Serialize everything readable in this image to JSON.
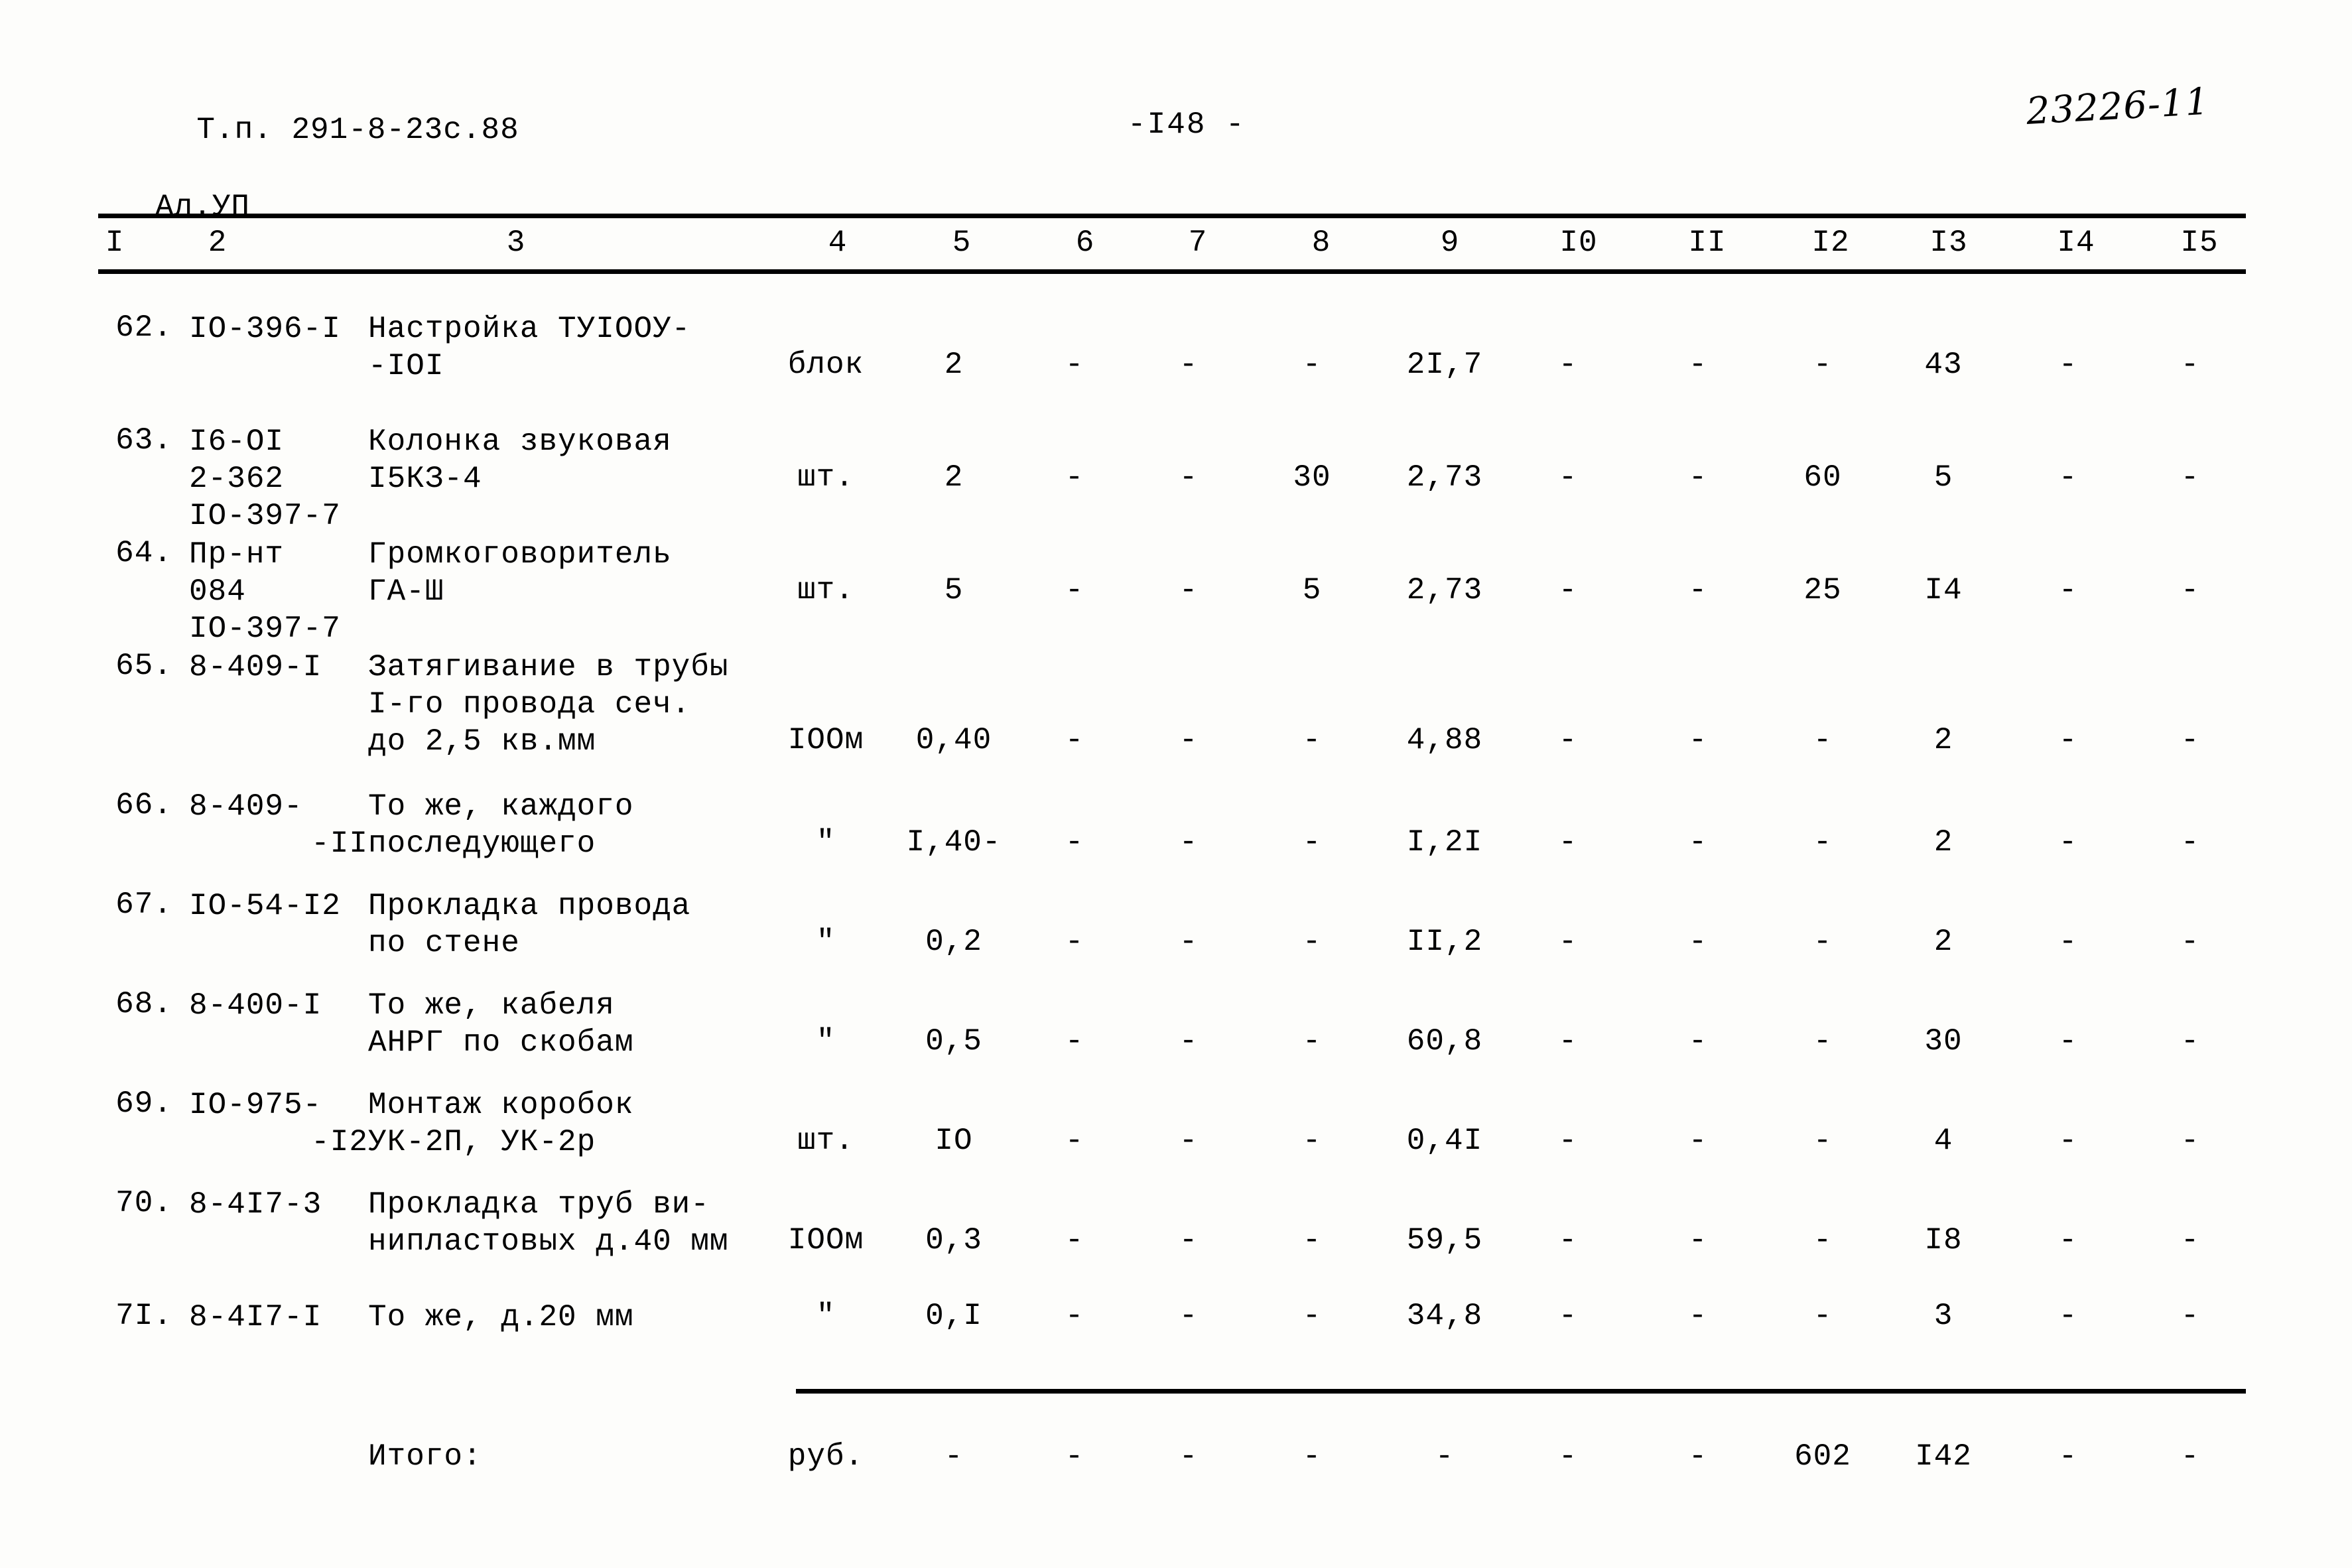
{
  "header": {
    "doc_code_line1": "Т.п. 291-8-23с.88",
    "doc_code_line2": "Ал.УП",
    "page_number": "-I48 -",
    "handwritten_note": "23226-11"
  },
  "table": {
    "column_headers": [
      "I",
      "2",
      "3",
      "4",
      "5",
      "6",
      "7",
      "8",
      "9",
      "I0",
      "II",
      "I2",
      "I3",
      "I4",
      "I5"
    ],
    "rows": [
      {
        "num": "62.",
        "code_lines": [
          "IO-396-I"
        ],
        "name_lines": [
          "Настройка ТУIООУ-",
          "-IОI"
        ],
        "unit": "блок",
        "c5": "2",
        "c6": "-",
        "c7": "-",
        "c8": "-",
        "c9": "2I,7",
        "c10": "-",
        "c11": "-",
        "c12": "-",
        "c13": "43",
        "c14": "-",
        "c15": "-"
      },
      {
        "num": "63.",
        "code_lines": [
          "I6-OI",
          "2-362",
          "IO-397-7"
        ],
        "name_lines": [
          "Колонка звуковая",
          "I5КЗ-4"
        ],
        "unit": "шт.",
        "c5": "2",
        "c6": "-",
        "c7": "-",
        "c8": "30",
        "c9": "2,73",
        "c10": "-",
        "c11": "-",
        "c12": "60",
        "c13": "5",
        "c14": "-",
        "c15": "-"
      },
      {
        "num": "64.",
        "code_lines": [
          "Пр-нт",
          "084",
          "IO-397-7"
        ],
        "name_lines": [
          "Громкоговоритель",
          "ГА-Ш"
        ],
        "unit": "шт.",
        "c5": "5",
        "c6": "-",
        "c7": "-",
        "c8": "5",
        "c9": "2,73",
        "c10": "-",
        "c11": "-",
        "c12": "25",
        "c13": "I4",
        "c14": "-",
        "c15": "-"
      },
      {
        "num": "65.",
        "code_lines": [
          "8-409-I"
        ],
        "name_lines": [
          "Затягивание в трубы",
          "I-го провода сеч.",
          "до 2,5 кв.мм"
        ],
        "unit": "IOOм",
        "c5": "0,40",
        "c6": "-",
        "c7": "-",
        "c8": "-",
        "c9": "4,88",
        "c10": "-",
        "c11": "-",
        "c12": "-",
        "c13": "2",
        "c14": "-",
        "c15": "-"
      },
      {
        "num": "66.",
        "code_lines": [
          "8-409-",
          "-II"
        ],
        "name_lines": [
          "То же, каждого",
          "последующего"
        ],
        "unit": "\"",
        "c5": "I,40-",
        "c6": "-",
        "c7": "-",
        "c8": "-",
        "c9": "I,2I",
        "c10": "-",
        "c11": "-",
        "c12": "-",
        "c13": "2",
        "c14": "-",
        "c15": "-"
      },
      {
        "num": "67.",
        "code_lines": [
          "IO-54-I2"
        ],
        "name_lines": [
          "Прокладка провода",
          "по стене"
        ],
        "unit": "\"",
        "c5": "0,2",
        "c6": "-",
        "c7": "-",
        "c8": "-",
        "c9": "II,2",
        "c10": "-",
        "c11": "-",
        "c12": "-",
        "c13": "2",
        "c14": "-",
        "c15": "-"
      },
      {
        "num": "68.",
        "code_lines": [
          "8-400-I"
        ],
        "name_lines": [
          "То же, кабеля",
          "АНРГ по скобам"
        ],
        "unit": "\"",
        "c5": "0,5",
        "c6": "-",
        "c7": "-",
        "c8": "-",
        "c9": "60,8",
        "c10": "-",
        "c11": "-",
        "c12": "-",
        "c13": "30",
        "c14": "-",
        "c15": "-"
      },
      {
        "num": "69.",
        "code_lines": [
          "IO-975-",
          "-I2"
        ],
        "name_lines": [
          "Монтаж коробок",
          "УК-2П, УК-2р"
        ],
        "unit": "шт.",
        "c5": "IO",
        "c6": "-",
        "c7": "-",
        "c8": "-",
        "c9": "0,4I",
        "c10": "-",
        "c11": "-",
        "c12": "-",
        "c13": "4",
        "c14": "-",
        "c15": "-"
      },
      {
        "num": "70.",
        "code_lines": [
          "8-4I7-3"
        ],
        "name_lines": [
          "Прокладка труб ви-",
          "нипластовых д.40 мм"
        ],
        "unit": "IOOм",
        "c5": "0,3",
        "c6": "-",
        "c7": "-",
        "c8": "-",
        "c9": "59,5",
        "c10": "-",
        "c11": "-",
        "c12": "-",
        "c13": "I8",
        "c14": "-",
        "c15": "-"
      },
      {
        "num": "7I.",
        "code_lines": [
          "8-4I7-I"
        ],
        "name_lines": [
          "То же, д.20 мм"
        ],
        "unit": "\"",
        "c5": "0,I",
        "c6": "-",
        "c7": "-",
        "c8": "-",
        "c9": "34,8",
        "c10": "-",
        "c11": "-",
        "c12": "-",
        "c13": "3",
        "c14": "-",
        "c15": "-"
      }
    ],
    "total": {
      "label": "Итого:",
      "unit": "руб.",
      "c5": "-",
      "c6": "-",
      "c7": "-",
      "c8": "-",
      "c9": "-",
      "c10": "-",
      "c11": "-",
      "c12": "602",
      "c13": "I42",
      "c14": "-",
      "c15": "-"
    }
  }
}
